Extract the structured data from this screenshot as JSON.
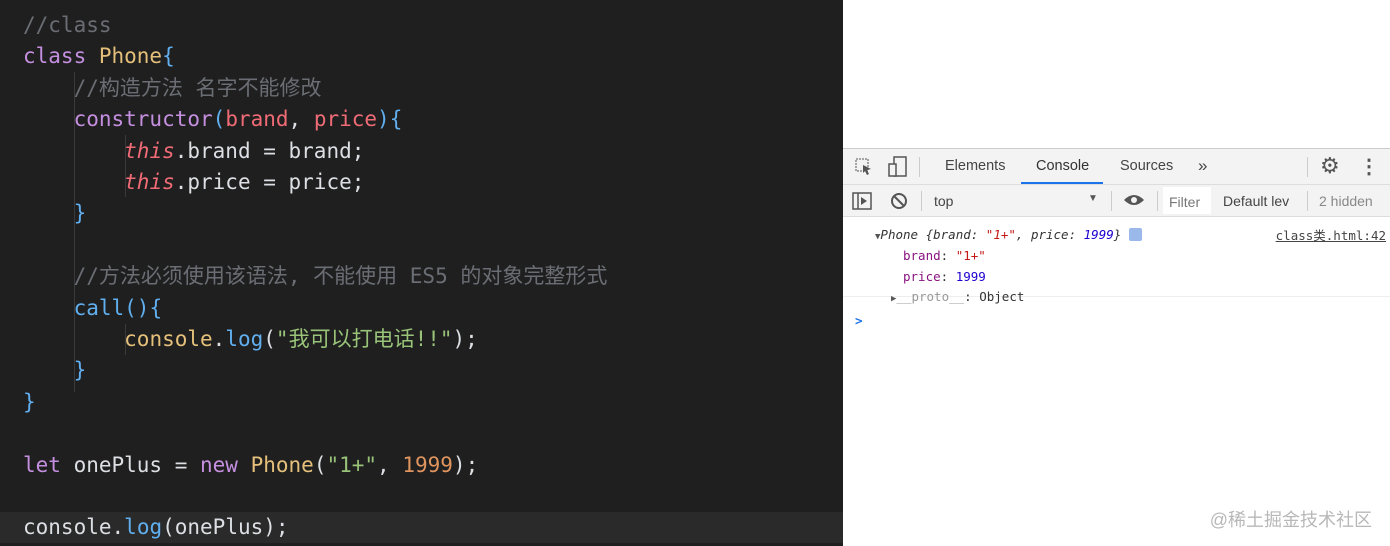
{
  "code": {
    "lines": [
      [
        [
          "//class",
          "cm"
        ]
      ],
      [
        [
          "class ",
          "kw"
        ],
        [
          "Phone",
          "cls"
        ],
        [
          "{",
          "br"
        ]
      ],
      [
        [
          "    ",
          ""
        ],
        [
          "//构造方法 名字不能修改",
          "cm"
        ]
      ],
      [
        [
          "    ",
          ""
        ],
        [
          "constructor",
          "kw"
        ],
        [
          "(",
          "br"
        ],
        [
          "brand",
          "par"
        ],
        [
          ", ",
          "pl"
        ],
        [
          "price",
          "par"
        ],
        [
          ")",
          "br"
        ],
        [
          "{",
          "br"
        ]
      ],
      [
        [
          "        ",
          ""
        ],
        [
          "this",
          "this"
        ],
        [
          ".brand = brand;",
          "pl"
        ]
      ],
      [
        [
          "        ",
          ""
        ],
        [
          "this",
          "this"
        ],
        [
          ".price = price;",
          "pl"
        ]
      ],
      [
        [
          "    ",
          ""
        ],
        [
          "}",
          "br"
        ]
      ],
      [],
      [
        [
          "    ",
          ""
        ],
        [
          "//方法必须使用该语法, 不能使用 ES5 的对象完整形式",
          "cm"
        ]
      ],
      [
        [
          "    ",
          ""
        ],
        [
          "call",
          "fn"
        ],
        [
          "(){",
          "br"
        ]
      ],
      [
        [
          "        ",
          ""
        ],
        [
          "console",
          "obj"
        ],
        [
          ".",
          "pl"
        ],
        [
          "log",
          "fn"
        ],
        [
          "(",
          "pl"
        ],
        [
          "\"我可以打电话!!\"",
          "str"
        ],
        [
          ");",
          "pl"
        ]
      ],
      [
        [
          "    ",
          ""
        ],
        [
          "}",
          "br"
        ]
      ],
      [
        [
          "}",
          "br"
        ]
      ],
      [],
      [
        [
          "let ",
          "kw"
        ],
        [
          "onePlus = ",
          "pl"
        ],
        [
          "new ",
          "kw"
        ],
        [
          "Phone",
          "cls"
        ],
        [
          "(",
          "pl"
        ],
        [
          "\"1+\"",
          "str"
        ],
        [
          ", ",
          "pl"
        ],
        [
          "1999",
          "num"
        ],
        [
          ");",
          "pl"
        ]
      ],
      [],
      [
        [
          "console",
          "pl"
        ],
        [
          ".",
          "pl"
        ],
        [
          "log",
          "fn"
        ],
        [
          "(onePlus);",
          "pl"
        ]
      ]
    ]
  },
  "devtools": {
    "tabs": [
      "Elements",
      "Console",
      "Sources"
    ],
    "active_tab": "Console",
    "more": "»",
    "context": "top",
    "filter_placeholder": "Filter",
    "levels": "Default lev",
    "hidden": "2 hidden",
    "log": {
      "summary_name": "Phone",
      "summary_rest_1": " {brand: ",
      "summary_brand": "\"1+\"",
      "summary_rest_2": ", price: ",
      "summary_price": "1999",
      "summary_rest_3": "}",
      "source": "class类.html:42",
      "brand_key": "brand",
      "brand_val": "\"1+\"",
      "price_key": "price",
      "price_val": "1999",
      "proto_key": "__proto__",
      "proto_val": "Object"
    },
    "prompt": ">"
  },
  "watermark": "@稀土掘金技术社区"
}
